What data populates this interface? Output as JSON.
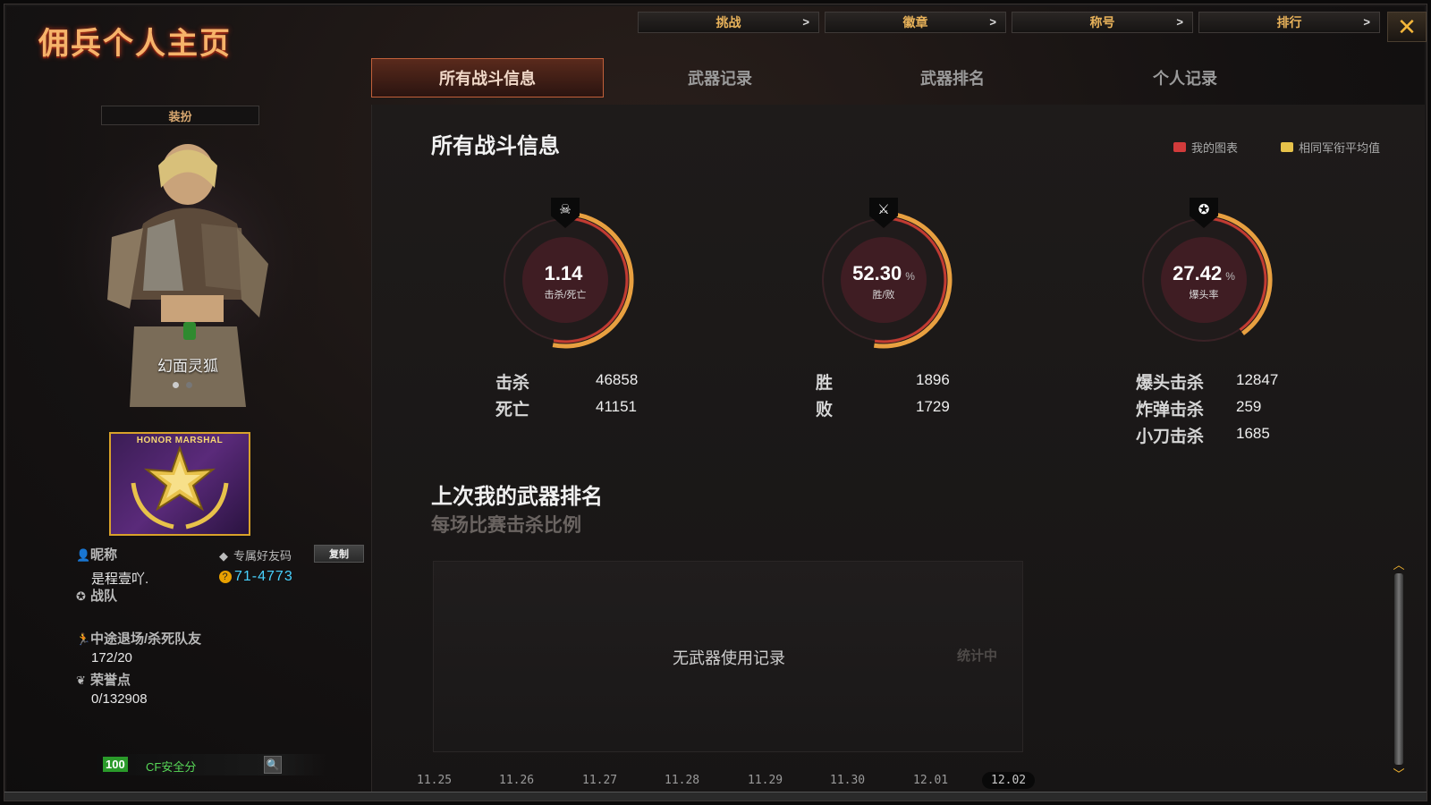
{
  "window": {
    "title": "佣兵个人主页"
  },
  "top_nav": [
    {
      "label": "挑战",
      "chevron": ">"
    },
    {
      "label": "徽章",
      "chevron": ">"
    },
    {
      "label": "称号",
      "chevron": ">"
    },
    {
      "label": "排行",
      "chevron": ">"
    }
  ],
  "close_symbol": "✕",
  "tabs": [
    {
      "label": "所有战斗信息",
      "active": true
    },
    {
      "label": "武器记录",
      "active": false
    },
    {
      "label": "武器排名",
      "active": false
    },
    {
      "label": "个人记录",
      "active": false
    }
  ],
  "sidebar": {
    "dress_button": "装扮",
    "character_name": "幻面灵狐",
    "rank_badge_text": "HONOR MARSHAL",
    "nickname_label": "昵称",
    "nickname_value": "是程壹吖.",
    "friend_code_label": "专属好友码",
    "copy_button": "复制",
    "friend_code_value": "71-4773",
    "team_label": "战队",
    "quit_label": "中途退场/杀死队友",
    "quit_value": "172/20",
    "honor_label": "荣誉点",
    "honor_value": "0/132908",
    "safety_score": "100",
    "safety_label": "CF安全分"
  },
  "main": {
    "section_title": "所有战斗信息",
    "legend": [
      {
        "label": "我的图表",
        "color": "#d23b3b"
      },
      {
        "label": "相同军衔平均值",
        "color": "#e6c24a"
      }
    ],
    "gauges": [
      {
        "value": "1.14",
        "unit": "",
        "label": "击杀/死亡",
        "fraction": 0.53,
        "emblem": "☠"
      },
      {
        "value": "52.30",
        "unit": "%",
        "label": "胜/败",
        "fraction": 0.523,
        "emblem": "⚔"
      },
      {
        "value": "27.42",
        "unit": "%",
        "label": "爆头率",
        "fraction": 0.4,
        "emblem": "✪"
      }
    ],
    "stats_kd": [
      {
        "label": "击杀",
        "value": "46858"
      },
      {
        "label": "死亡",
        "value": "41151"
      }
    ],
    "stats_wl": [
      {
        "label": "胜",
        "value": "1896"
      },
      {
        "label": "败",
        "value": "1729"
      }
    ],
    "stats_hs": [
      {
        "label": "爆头击杀",
        "value": "12847"
      },
      {
        "label": "炸弹击杀",
        "value": "259"
      },
      {
        "label": "小刀击杀",
        "value": "1685"
      }
    ],
    "weapon_rank_title": "上次我的武器排名",
    "weapon_rank_subtitle": "每场比赛击杀比例",
    "chart_empty_text": "无武器使用记录",
    "chart_counting_text": "统计中",
    "dates": [
      "11.25",
      "11.26",
      "11.27",
      "11.28",
      "11.29",
      "11.30",
      "12.01",
      "12.02"
    ],
    "selected_date": "12.02"
  }
}
